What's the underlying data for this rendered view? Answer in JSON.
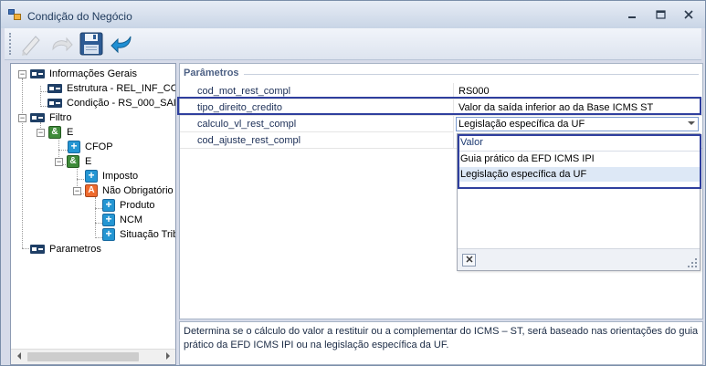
{
  "window": {
    "title": "Condição do Negócio",
    "controls": {
      "minimize": "▭",
      "maximize": "▣",
      "close": "✕"
    }
  },
  "toolbar": {
    "buttons": [
      {
        "icon": "edit-icon"
      },
      {
        "icon": "redo-icon"
      },
      {
        "icon": "save-icon"
      },
      {
        "icon": "undo-icon"
      }
    ]
  },
  "tree": {
    "informacoes_gerais": "Informações Gerais",
    "estrutura": "Estrutura - REL_INF_CO",
    "condicao": "Condição - RS_000_SAI(",
    "filtro": "Filtro",
    "e1": "E",
    "cfop": "CFOP",
    "e2": "E",
    "imposto": "Imposto",
    "nao_obrigatorio": "Não Obrigatório",
    "produto": "Produto",
    "ncm": "NCM",
    "situacao_trib": "Situação Trib",
    "parametros": "Parametros",
    "icon_and": "&",
    "icon_plus": "+",
    "icon_a": "A",
    "expander_open": "−"
  },
  "params": {
    "section_title": "Parâmetros",
    "rows": [
      {
        "name": "cod_mot_rest_compl",
        "value": "RS000"
      },
      {
        "name": "tipo_direito_credito",
        "value": "Valor da saída inferior ao da Base ICMS ST"
      },
      {
        "name": "calculo_vl_rest_compl",
        "value": "Legislação específica da UF"
      },
      {
        "name": "cod_ajuste_rest_compl",
        "value": ""
      }
    ]
  },
  "dropdown": {
    "header": "Valor",
    "options": [
      "Guia prático da EFD ICMS IPI",
      "Legislação específica da UF"
    ],
    "selected_index": 1
  },
  "description": "Determina se o cálculo do valor a restituir ou a complementar do ICMS – ST, será baseado nas orientações do guia prático da EFD ICMS IPI ou na legislação específica da UF.",
  "colors": {
    "selection_border": "#2f3f9e",
    "section_title": "#4d6185",
    "highlight": "#dde8f6"
  }
}
